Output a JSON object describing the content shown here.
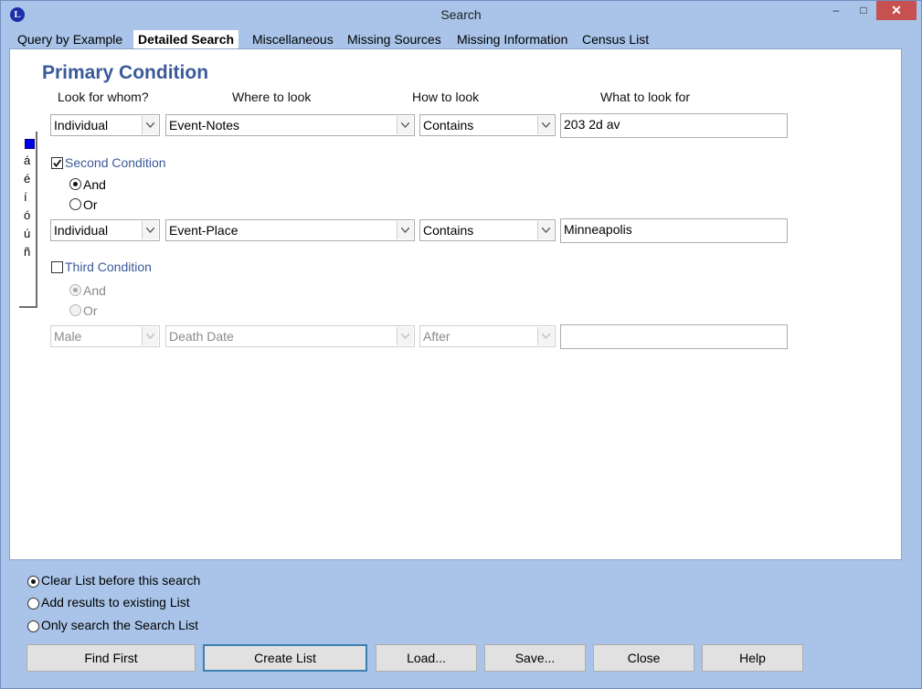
{
  "window": {
    "title": "Search",
    "app_icon": "L",
    "controls": {
      "minimize": "–",
      "maximize": "□",
      "close": "✕"
    }
  },
  "tabs": [
    {
      "label": "Query by Example",
      "active": false
    },
    {
      "label": "Detailed Search",
      "active": true
    },
    {
      "label": "Miscellaneous",
      "active": false
    },
    {
      "label": "Missing Sources",
      "active": false
    },
    {
      "label": "Missing Information",
      "active": false
    },
    {
      "label": "Census List",
      "active": false
    }
  ],
  "panel": {
    "heading": "Primary Condition",
    "columns": {
      "who": "Look for whom?",
      "where": "Where to look",
      "how": "How to look",
      "what": "What to look for"
    },
    "accent_chars": [
      "á",
      "é",
      "í",
      "ó",
      "ú",
      "ñ"
    ],
    "primary": {
      "who": "Individual",
      "where": "Event-Notes",
      "how": "Contains",
      "what": "203 2d av"
    },
    "second": {
      "label": "Second Condition",
      "checked": true,
      "and_label": "And",
      "or_label": "Or",
      "selected": "and",
      "who": "Individual",
      "where": "Event-Place",
      "how": "Contains",
      "what": "Minneapolis"
    },
    "third": {
      "label": "Third Condition",
      "checked": false,
      "and_label": "And",
      "or_label": "Or",
      "selected": "and",
      "who": "Male",
      "where": "Death Date",
      "how": "After",
      "what": ""
    }
  },
  "options": [
    {
      "label": "Clear List before this search",
      "selected": true
    },
    {
      "label": "Add results to existing List",
      "selected": false
    },
    {
      "label": "Only search the Search List",
      "selected": false
    }
  ],
  "buttons": {
    "find_first": "Find First",
    "create_list": "Create List",
    "load": "Load...",
    "save": "Save...",
    "close": "Close",
    "help": "Help"
  },
  "colors": {
    "frame": "#a9c4e8",
    "heading": "#3a5a9a",
    "close_button": "#c75050",
    "default_button_border": "#3c7fb1"
  }
}
